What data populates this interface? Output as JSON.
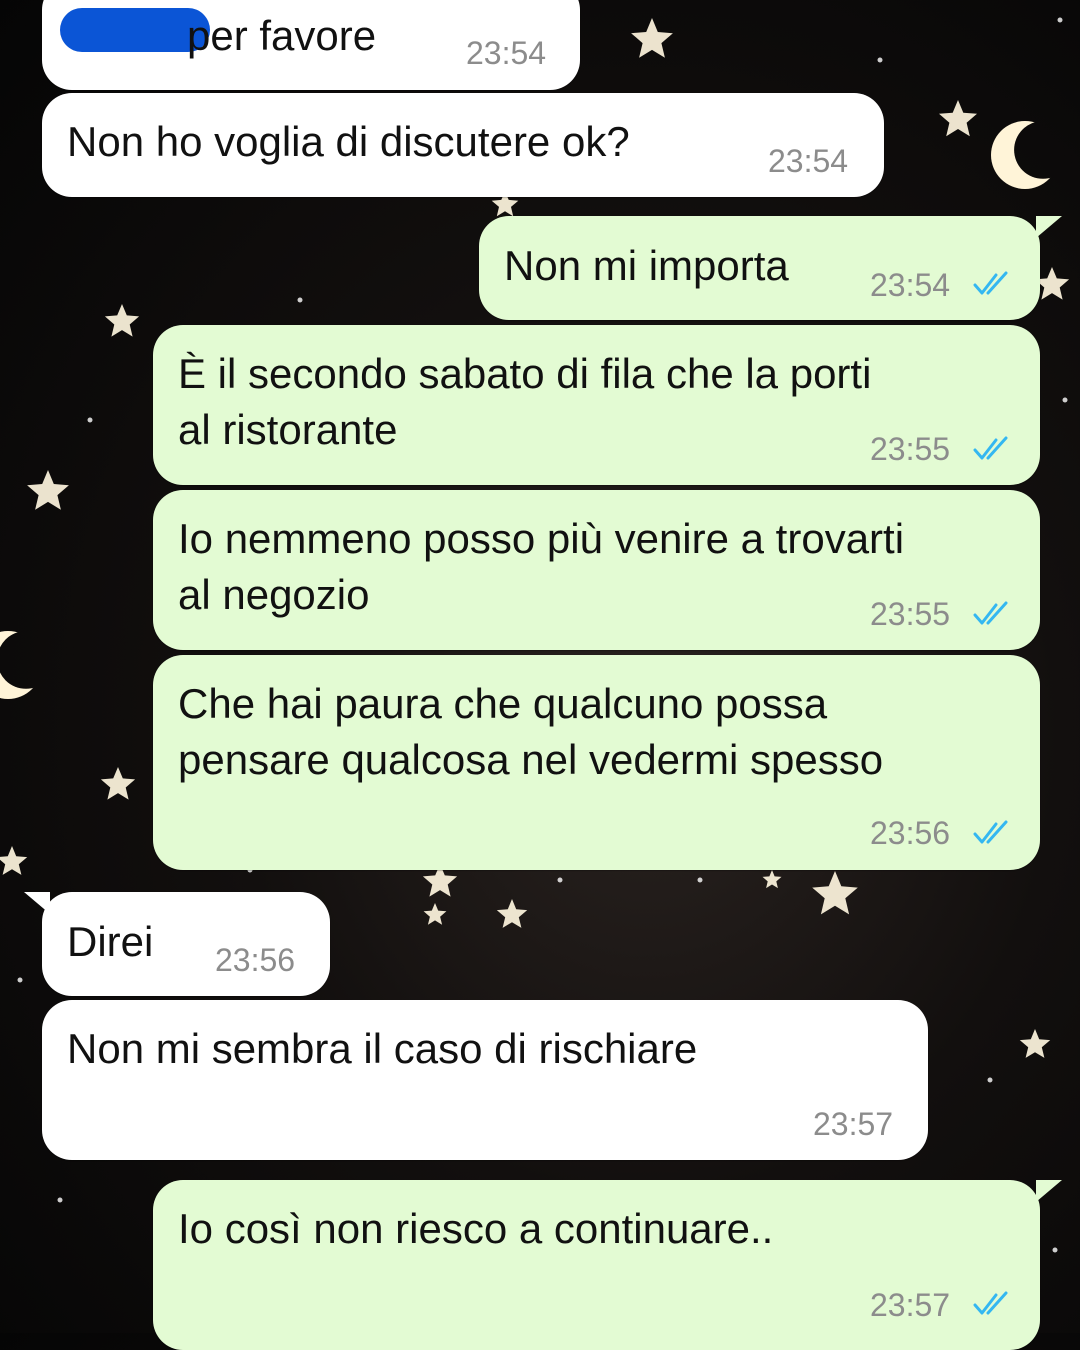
{
  "conversation": {
    "messages": [
      {
        "dir": "in",
        "text": "per favore",
        "time": "23:54",
        "redacted_prefix": true
      },
      {
        "dir": "in",
        "text": "Non ho voglia di discutere ok?",
        "time": "23:54"
      },
      {
        "dir": "out",
        "text": "Non mi importa",
        "time": "23:54",
        "status": "read"
      },
      {
        "dir": "out",
        "line1": "È il secondo sabato di fila che la porti",
        "line2": "al ristorante",
        "time": "23:55",
        "status": "read"
      },
      {
        "dir": "out",
        "line1": "Io nemmeno posso più venire a trovarti",
        "line2": "al negozio",
        "time": "23:55",
        "status": "read"
      },
      {
        "dir": "out",
        "line1": "Che hai paura che qualcuno possa",
        "line2": "pensare qualcosa nel vedermi spesso",
        "time": "23:56",
        "status": "read"
      },
      {
        "dir": "in",
        "text": "Direi",
        "time": "23:56"
      },
      {
        "dir": "in",
        "text": "Non mi sembra il caso di rischiare",
        "time": "23:57"
      },
      {
        "dir": "out",
        "text": "Io così non riesco a continuare..",
        "time": "23:57",
        "status": "read"
      }
    ]
  },
  "colors": {
    "incoming_bubble": "#ffffff",
    "outgoing_bubble": "#e3fbd3",
    "read_ticks": "#34b7f1",
    "timestamp": "#8c8c8c",
    "redaction": "#0b55d6"
  },
  "icons": {
    "read_status": "double-check-icon",
    "background_moon": "crescent-moon-icon",
    "background_star": "star-icon"
  }
}
